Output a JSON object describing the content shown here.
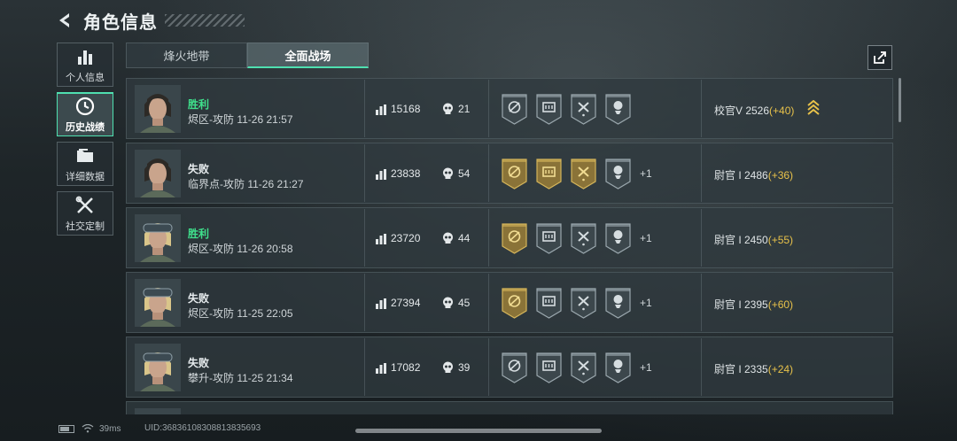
{
  "header": {
    "title": "角色信息"
  },
  "nav": [
    {
      "label": "个人信息",
      "icon": "bar-chart-icon",
      "active": false
    },
    {
      "label": "历史战绩",
      "icon": "clock-icon",
      "active": true
    },
    {
      "label": "详细数据",
      "icon": "folder-icon",
      "active": false
    },
    {
      "label": "社交定制",
      "icon": "tools-icon",
      "active": false
    }
  ],
  "tabs": [
    {
      "label": "烽火地带",
      "active": false
    },
    {
      "label": "全面战场",
      "active": true
    }
  ],
  "matches": [
    {
      "result": "胜利",
      "outcome": "win",
      "map": "烬区-攻防 11-26 21:57",
      "score": "15168",
      "kills": "21",
      "badges": [
        "silver",
        "silver",
        "silver",
        "silver"
      ],
      "more": "",
      "rank": "校官V 2526",
      "delta": "(+40)",
      "rank_icon": "chevron-rank-icon",
      "avatar": "dark-hair"
    },
    {
      "result": "失败",
      "outcome": "lose",
      "map": "临界点-攻防 11-26 21:27",
      "score": "23838",
      "kills": "54",
      "badges": [
        "gold",
        "gold",
        "gold",
        "silver"
      ],
      "more": "+1",
      "rank": "尉官 I 2486",
      "delta": "(+36)",
      "rank_icon": "",
      "avatar": "dark-hair"
    },
    {
      "result": "胜利",
      "outcome": "win",
      "map": "烬区-攻防 11-26 20:58",
      "score": "23720",
      "kills": "44",
      "badges": [
        "gold",
        "silver",
        "silver",
        "silver"
      ],
      "more": "+1",
      "rank": "尉官 I 2450",
      "delta": "(+55)",
      "rank_icon": "",
      "avatar": "blonde"
    },
    {
      "result": "失败",
      "outcome": "lose",
      "map": "烬区-攻防 11-25 22:05",
      "score": "27394",
      "kills": "45",
      "badges": [
        "gold",
        "silver",
        "silver",
        "silver"
      ],
      "more": "+1",
      "rank": "尉官 I 2395",
      "delta": "(+60)",
      "rank_icon": "",
      "avatar": "blonde"
    },
    {
      "result": "失败",
      "outcome": "lose",
      "map": "攀升-攻防 11-25 21:34",
      "score": "17082",
      "kills": "39",
      "badges": [
        "silver",
        "silver",
        "silver",
        "silver"
      ],
      "more": "+1",
      "rank": "尉官 I 2335",
      "delta": "(+24)",
      "rank_icon": "",
      "avatar": "blonde"
    }
  ],
  "status": {
    "ping": "39ms",
    "uid": "UID:36836108308813835693"
  },
  "colors": {
    "accent": "#4fe0b0",
    "win": "#3fe08c",
    "gold": "#c9a53d",
    "delta": "#e8c24a"
  }
}
